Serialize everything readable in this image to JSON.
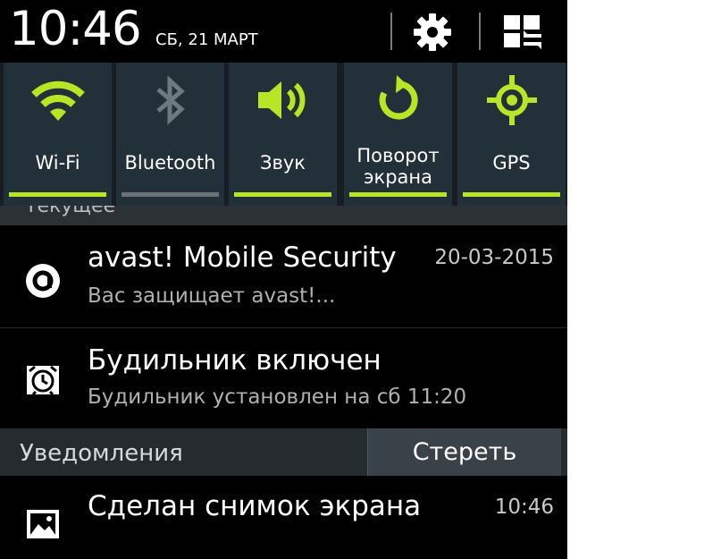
{
  "status_bar": {
    "time": "10:46",
    "date": "СБ, 21 МАРТ",
    "settings_icon": "gear-icon",
    "quick_panel_icon": "grid-edit-icon"
  },
  "quick_toggles": [
    {
      "label": "Wi-Fi",
      "icon": "wifi-icon",
      "active": true
    },
    {
      "label": "Bluetooth",
      "icon": "bluetooth-icon",
      "active": false
    },
    {
      "label": "Звук",
      "icon": "sound-icon",
      "active": true
    },
    {
      "label_line1": "Поворот",
      "label_line2": "экрана",
      "icon": "rotate-icon",
      "active": true
    },
    {
      "label": "GPS",
      "icon": "gps-icon",
      "active": true
    }
  ],
  "ongoing_section": {
    "label": "Текущее"
  },
  "ongoing": [
    {
      "title": "avast! Mobile Security",
      "subtitle": "Вас защищает avast!...",
      "time": "20-03-2015",
      "icon": "avast-icon"
    },
    {
      "title": "Будильник включен",
      "subtitle": "Будильник установлен на сб 11:20",
      "icon": "alarm-clock-icon"
    }
  ],
  "notifications_section": {
    "label": "Уведомления",
    "clear_label": "Стереть"
  },
  "notifications": [
    {
      "title": "Сделан снимок экрана",
      "time": "10:46",
      "icon": "image-icon"
    }
  ],
  "colors": {
    "accent": "#b8e627",
    "inactive_bar": "#6a7277",
    "toggle_bg": "#223039",
    "background": "#000000"
  }
}
